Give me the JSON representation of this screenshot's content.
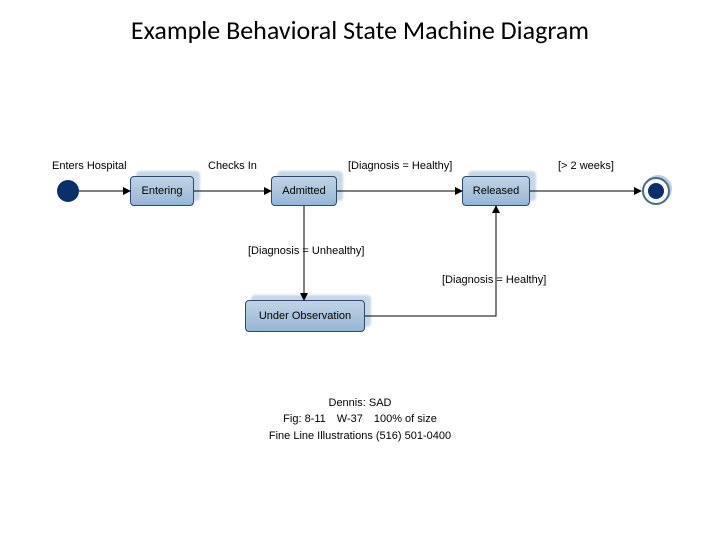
{
  "title": "Example Behavioral State Machine Diagram",
  "states": {
    "entering": "Entering",
    "admitted": "Admitted",
    "underObservation": "Under Observation",
    "released": "Released"
  },
  "transitions": {
    "entersHospital": "Enters Hospital",
    "checksIn": "Checks In",
    "diagHealthy1": "[Diagnosis = Healthy]",
    "diagUnhealthy": "[Diagnosis = Unhealthy]",
    "diagHealthy2": "[Diagnosis = Healthy]",
    "gt2weeks": "[> 2 weeks]"
  },
  "footer": {
    "line1": "Dennis: SAD",
    "line2": "Fig: 8-11 W-37 100% of size",
    "line3": "Fine Line Illustrations (516) 501-0400"
  }
}
